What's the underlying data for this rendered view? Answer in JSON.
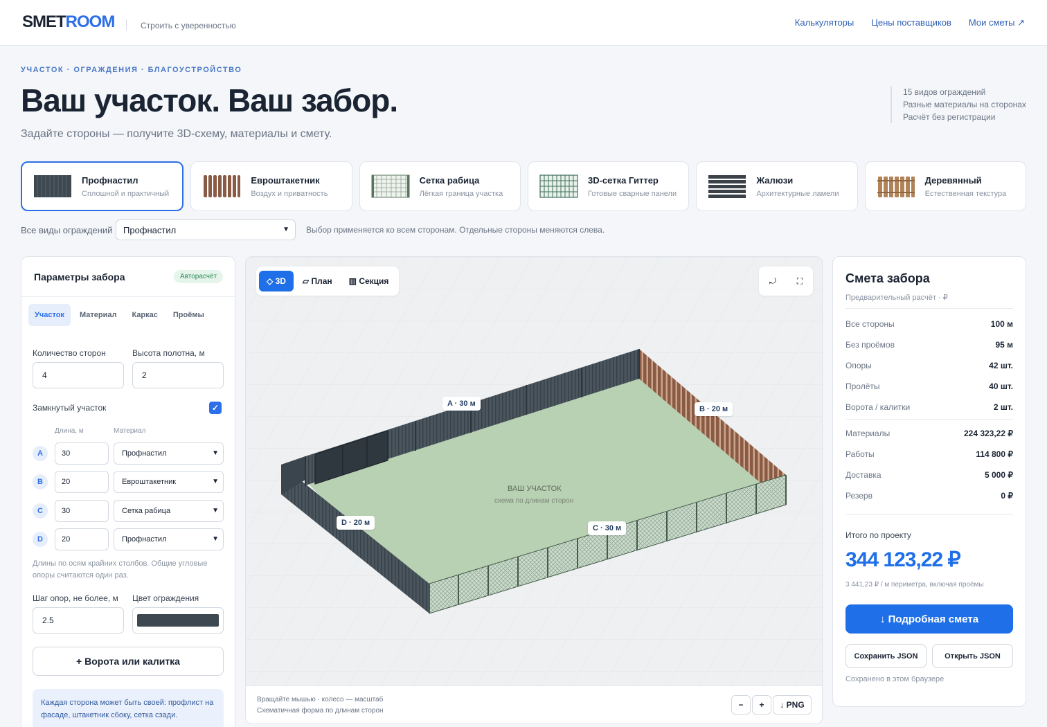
{
  "header": {
    "logo_a": "SMET",
    "logo_b": "ROOM",
    "tagline": "Строить с уверенностью",
    "nav": [
      "Калькуляторы",
      "Цены поставщиков",
      "Мои сметы ↗"
    ]
  },
  "hero": {
    "crumb": "УЧАСТОК · ОГРАЖДЕНИЯ · БЛАГОУСТРОЙСТВО",
    "title": "Ваш участок. Ваш забор.",
    "subtitle": "Задайте стороны — получите 3D-схему, материалы и смету.",
    "features": [
      "15 видов ограждений",
      "Разные материалы на сторонах",
      "Расчёт без регистрации"
    ]
  },
  "types": [
    {
      "name": "Профнастил",
      "desc": "Сплошной и практичный",
      "icon": "profnastil-icon",
      "color": "#3e4850"
    },
    {
      "name": "Евроштакетник",
      "desc": "Воздух и приватность",
      "icon": "picket-icon",
      "color": "#8a5a44"
    },
    {
      "name": "Сетка рабица",
      "desc": "Лёгкая граница участка",
      "icon": "chainlink-icon",
      "color": "#5a7560"
    },
    {
      "name": "3D-сетка Гиттер",
      "desc": "Готовые сварные панели",
      "icon": "gitter-icon",
      "color": "#3f6f5a"
    },
    {
      "name": "Жалюзи",
      "desc": "Архитектурные ламели",
      "icon": "louver-icon",
      "color": "#3a4148"
    },
    {
      "name": "Деревянный",
      "desc": "Естественная текстура",
      "icon": "wood-icon",
      "color": "#b08358"
    }
  ],
  "all_types": {
    "label": "Все виды ограждений",
    "selected": "Профнастил",
    "hint": "Выбор применяется ко всем сторонам. Отдельные стороны меняются слева."
  },
  "params": {
    "title": "Параметры забора",
    "badge": "Авторасчёт",
    "tabs": [
      "Участок",
      "Материал",
      "Каркас",
      "Проёмы"
    ],
    "sides_label": "Количество сторон",
    "sides_value": "4",
    "height_label": "Высота полотна, м",
    "height_value": "2",
    "closed_label": "Замкнутый участок",
    "col_len": "Длина, м",
    "col_mat": "Материал",
    "sides": [
      {
        "id": "A",
        "len": "30",
        "mat": "Профнастил"
      },
      {
        "id": "B",
        "len": "20",
        "mat": "Евроштакетник"
      },
      {
        "id": "C",
        "len": "30",
        "mat": "Сетка рабица"
      },
      {
        "id": "D",
        "len": "20",
        "mat": "Профнастил"
      }
    ],
    "note": "Длины по осям крайних столбов. Общие угловые опоры считаются один раз.",
    "step_label": "Шаг опор, не более, м",
    "step_value": "2.5",
    "color_label": "Цвет ограждения",
    "fence_color": "#3e4850",
    "gate_button": "+ Ворота или калитка",
    "tip": "Каждая сторона может быть своей: профлист на фасаде, штакетник сбоку, сетка сзади."
  },
  "viewer": {
    "tabs": [
      "◇ 3D",
      "▱ План",
      "▥ Секция"
    ],
    "tools": [
      "⤾",
      "⛶"
    ],
    "labels": {
      "a": "A · 30 м",
      "b": "B · 20 м",
      "c": "C · 30 м",
      "d": "D · 20 м"
    },
    "plot_title": "ВАШ УЧАСТОК",
    "plot_sub": "схема по длинам сторон",
    "hint1": "Вращайте мышью · колесо — масштаб",
    "hint2": "Схематичная форма по длинам сторон",
    "zoom_out": "−",
    "zoom_in": "+",
    "png": "↓ PNG"
  },
  "estimate": {
    "title": "Смета забора",
    "subtitle": "Предварительный расчёт · ₽",
    "rows1": [
      {
        "k": "Все стороны",
        "v": "100 м"
      },
      {
        "k": "Без проёмов",
        "v": "95 м"
      },
      {
        "k": "Опоры",
        "v": "42 шт."
      },
      {
        "k": "Пролёты",
        "v": "40 шт."
      },
      {
        "k": "Ворота / калитки",
        "v": "2 шт."
      }
    ],
    "rows2": [
      {
        "k": "Материалы",
        "v": "224 323,22 ₽"
      },
      {
        "k": "Работы",
        "v": "114 800 ₽"
      },
      {
        "k": "Доставка",
        "v": "5 000 ₽"
      },
      {
        "k": "Резерв",
        "v": "0 ₽"
      }
    ],
    "total_label": "Итого по проекту",
    "total": "344 123,22 ₽",
    "per_meter": "3 441,23 ₽ / м периметра, включая проёмы",
    "main_button": "↓ Подробная смета",
    "save_button": "Сохранить JSON",
    "open_button": "Открыть JSON",
    "saved_note": "Сохранено в этом браузере"
  }
}
